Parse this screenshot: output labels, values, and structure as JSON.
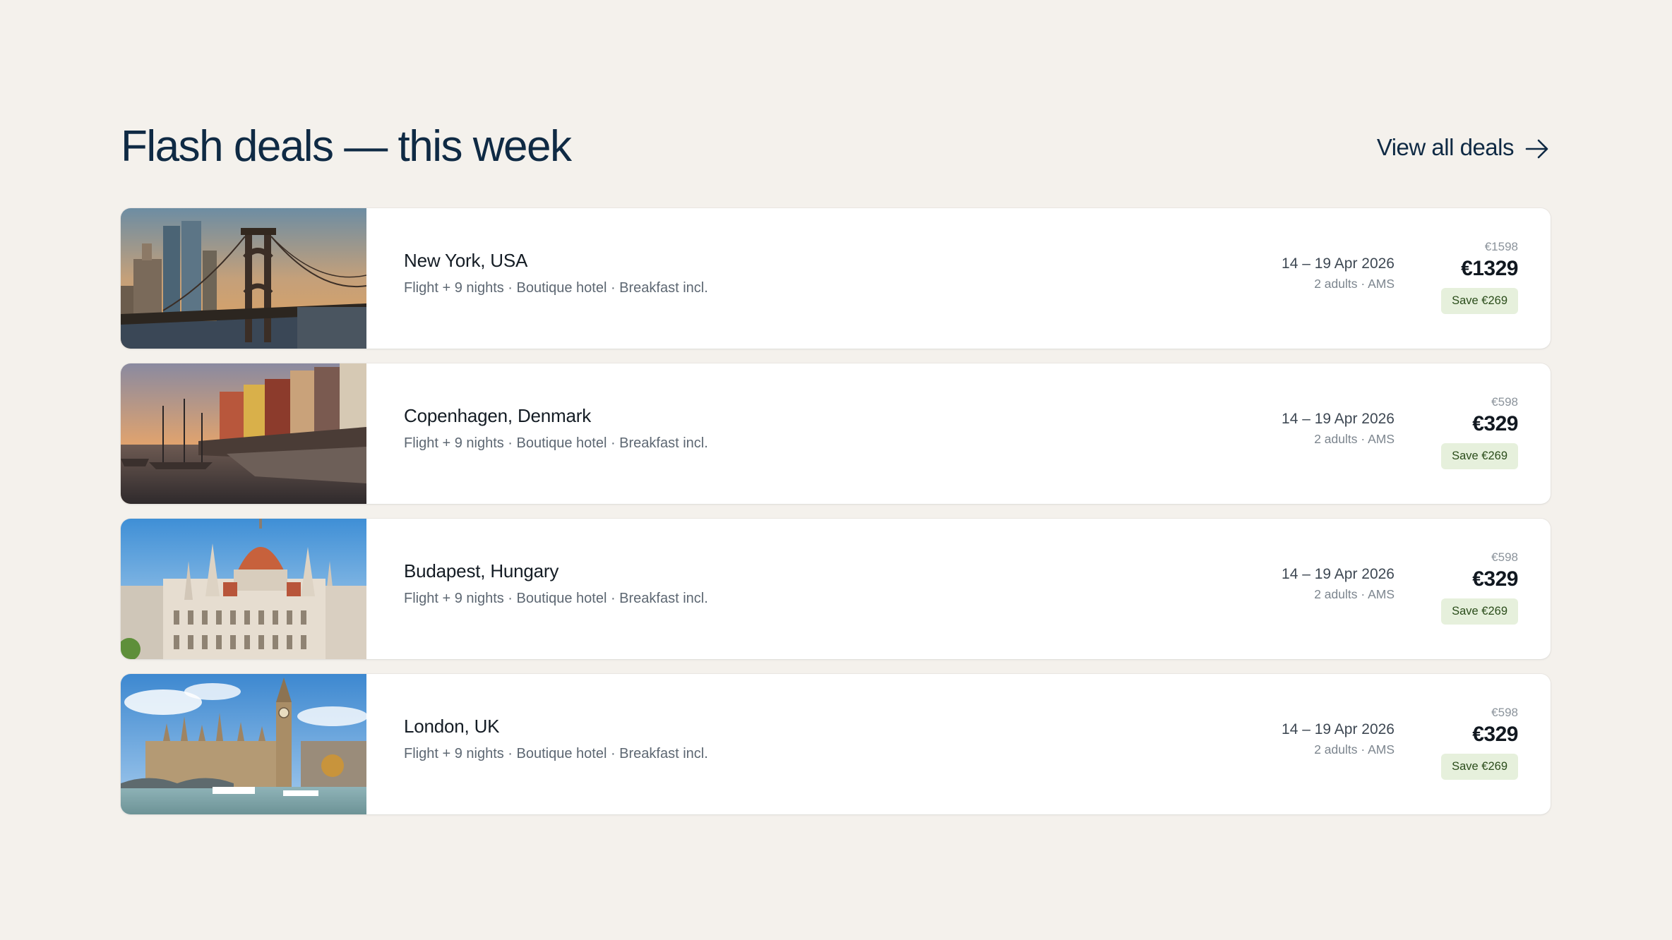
{
  "header": {
    "title": "Flash deals — this week",
    "view_all_label": "View all deals"
  },
  "deals": [
    {
      "destination": "New York, USA",
      "description": "Flight + 9 nights · Boutique hotel · Breakfast incl.",
      "dates": "14 – 19 Apr 2026",
      "travellers": "2 adults · AMS",
      "old_price": "€1598",
      "price": "€1329",
      "savings": "Save €269",
      "image": "brooklyn-bridge-sunset"
    },
    {
      "destination": "Copenhagen, Denmark",
      "description": "Flight + 9 nights · Boutique hotel · Breakfast incl.",
      "dates": "14 – 19 Apr 2026",
      "travellers": "2 adults · AMS",
      "old_price": "€598",
      "price": "€329",
      "savings": "Save €269",
      "image": "nyhavn-canal-sunset"
    },
    {
      "destination": "Budapest, Hungary",
      "description": "Flight + 9 nights · Boutique hotel · Breakfast incl.",
      "dates": "14 – 19 Apr 2026",
      "travellers": "2 adults · AMS",
      "old_price": "€598",
      "price": "€329",
      "savings": "Save €269",
      "image": "hungarian-parliament"
    },
    {
      "destination": "London, UK",
      "description": "Flight + 9 nights · Boutique hotel · Breakfast incl.",
      "dates": "14 – 19 Apr 2026",
      "travellers": "2 adults · AMS",
      "old_price": "€598",
      "price": "€329",
      "savings": "Save €269",
      "image": "westminster-big-ben"
    }
  ],
  "colors": {
    "background": "#f4f1ec",
    "title": "#0f2a44",
    "save_badge_bg": "#e6f0dc",
    "save_badge_text": "#2b4d1b"
  }
}
